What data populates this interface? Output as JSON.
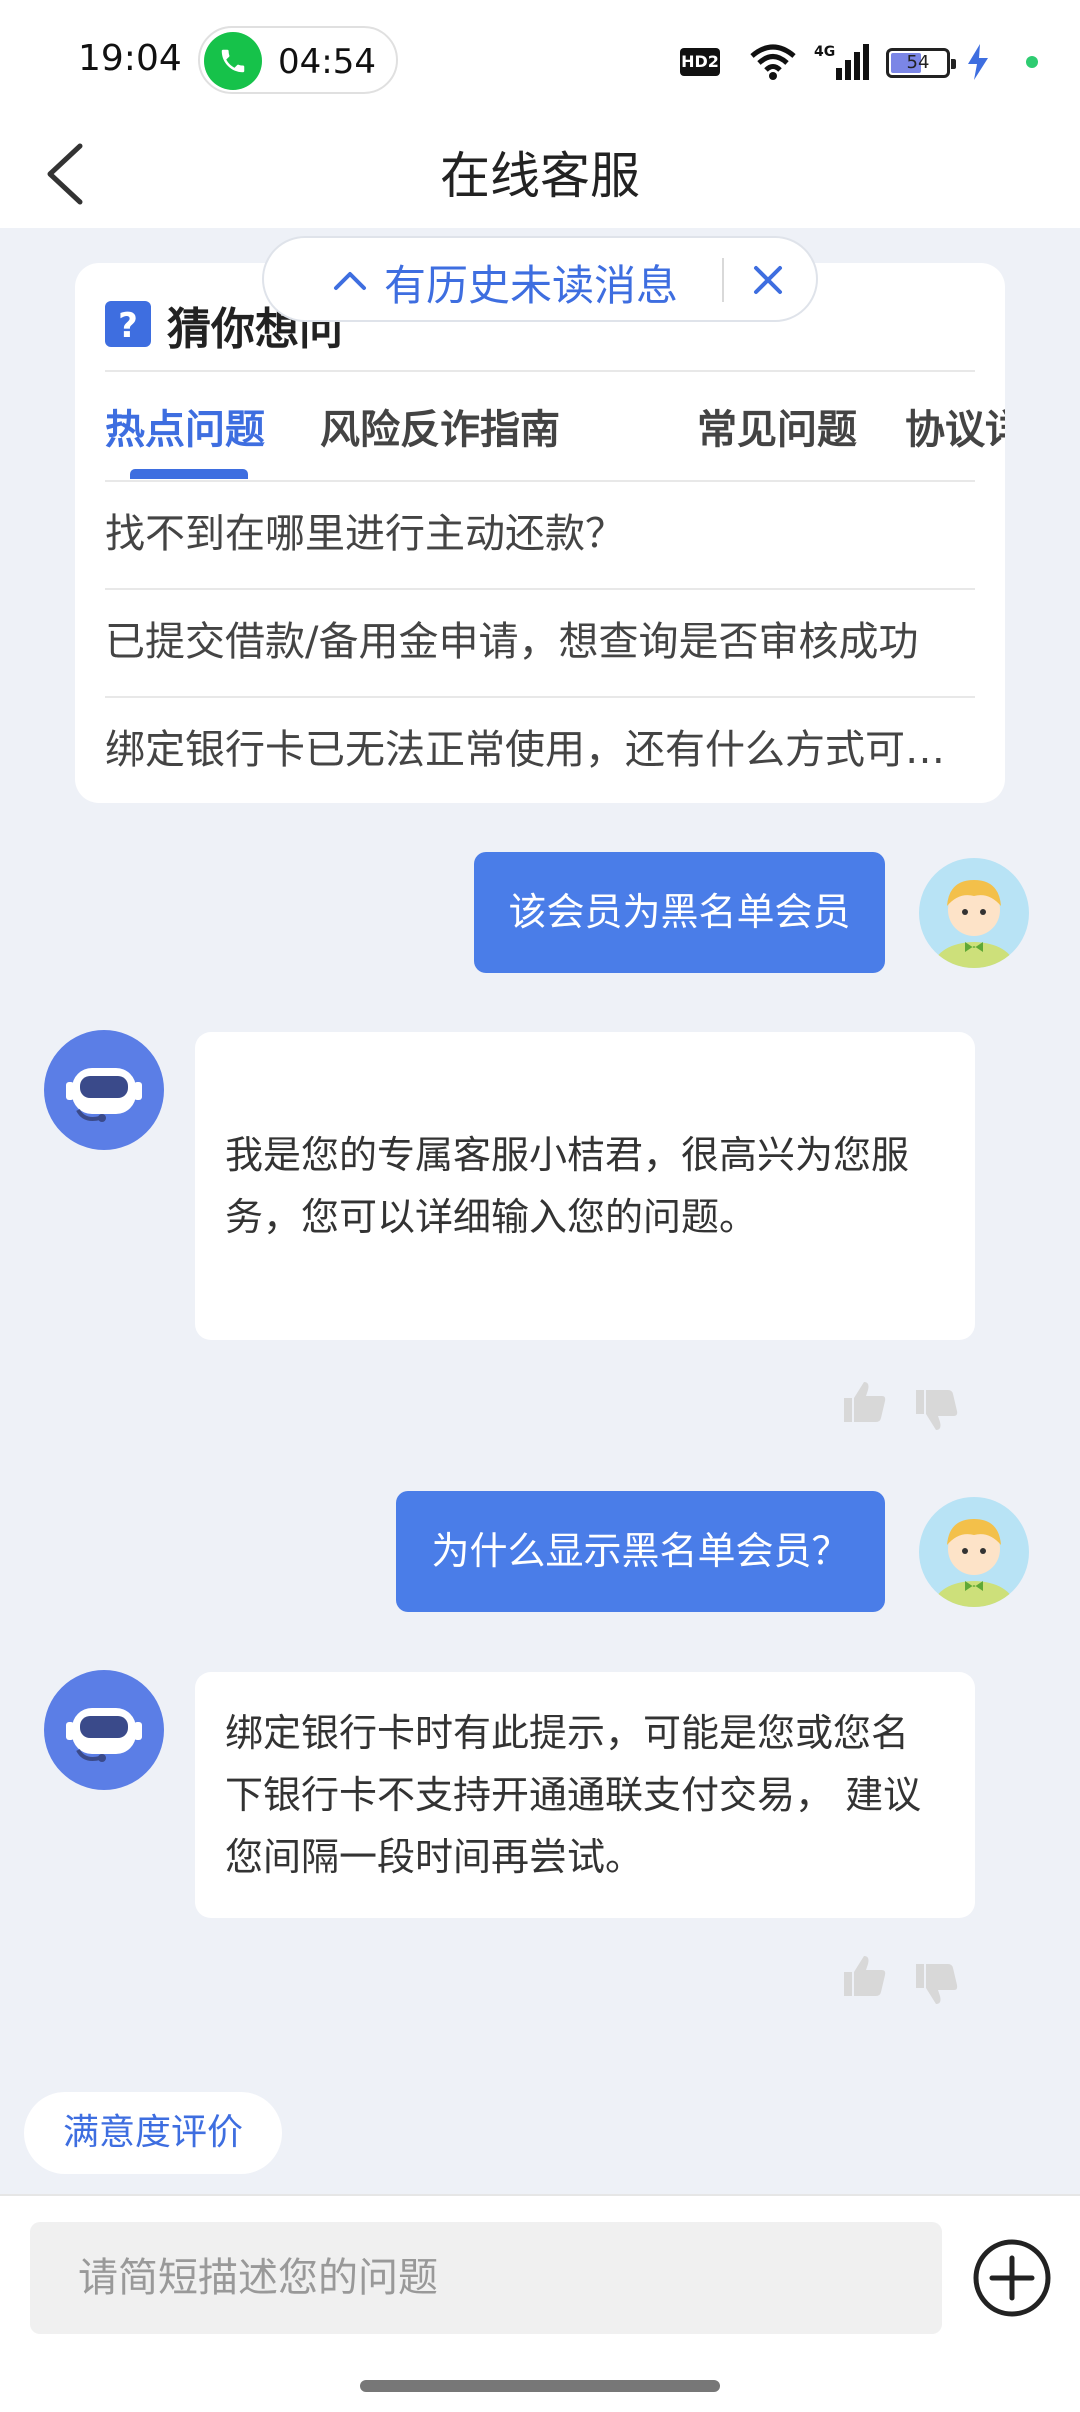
{
  "status_bar": {
    "time": "19:04",
    "call_duration": "04:54",
    "hd_label": "HD2",
    "battery_level": "54",
    "accent_call_color": "#16c24a"
  },
  "header": {
    "title": "在线客服",
    "back_icon": "chevron-left-icon"
  },
  "unread_banner": {
    "text": "有历史未读消息",
    "expand_icon": "chevron-up-icon",
    "close_icon": "close-icon"
  },
  "faq": {
    "title": "猜你想问",
    "tabs": [
      {
        "label": "热点问题",
        "active": true
      },
      {
        "label": "风险反诈指南",
        "active": false
      },
      {
        "label": "常见问题",
        "active": false
      },
      {
        "label": "协议详情",
        "active": false
      }
    ],
    "items": [
      "找不到在哪里进行主动还款？",
      "已提交借款/备用金申请，想查询是否审核成功",
      "绑定银行卡已无法正常使用，还有什么方式可以还款"
    ]
  },
  "messages": [
    {
      "sender": "user",
      "text": "该会员为黑名单会员"
    },
    {
      "sender": "bot",
      "text": "我是您的专属客服小桔君，很高兴为您服务，您可以详细输入您的问题。"
    },
    {
      "sender": "user",
      "text": "为什么显示黑名单会员？"
    },
    {
      "sender": "bot",
      "text": "绑定银行卡时有此提示，可能是您或您名下银行卡不支持开通通联支付交易， 建议您间隔一段时间再尝试。"
    }
  ],
  "satisfaction": {
    "label": "满意度评价"
  },
  "input": {
    "placeholder": "请简短描述您的问题",
    "add_icon": "plus-circle-icon"
  },
  "colors": {
    "accent": "#3e6ee0",
    "user_bubble": "#4a7de8",
    "background": "#eef1f7"
  }
}
